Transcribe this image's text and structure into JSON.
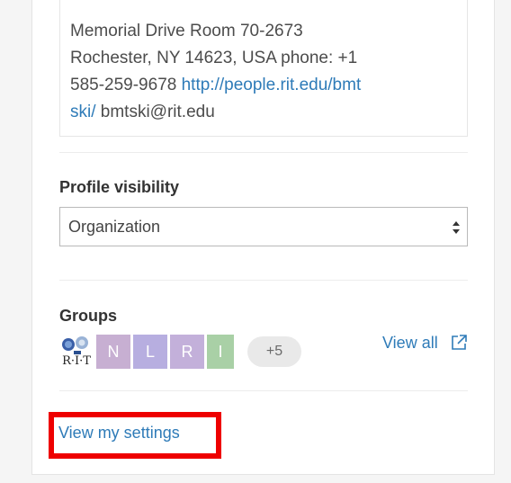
{
  "contact": {
    "line_address": "Memorial Drive Room 70-2673",
    "line_city": "Rochester, NY 14623, USA phone: +1",
    "line_phone": "585-259-9678",
    "url_part1": "http://people.rit.edu/bmt",
    "url_part2": "ski/",
    "email": "bmtski@rit.edu"
  },
  "profile_visibility": {
    "label": "Profile visibility",
    "selected": "Organization"
  },
  "groups": {
    "label": "Groups",
    "logo_text": "R·I·T",
    "tiles": [
      {
        "letter": "N",
        "color": "#c7afd2"
      },
      {
        "letter": "L",
        "color": "#b7aee0"
      },
      {
        "letter": "R",
        "color": "#c3b0da"
      },
      {
        "letter": "I",
        "color": "#a9d0a6"
      }
    ],
    "more_count": "+5",
    "view_all_label": "View all"
  },
  "settings_link": "View my settings",
  "colors": {
    "link": "#2e7bb8",
    "highlight": "#ee0000"
  }
}
